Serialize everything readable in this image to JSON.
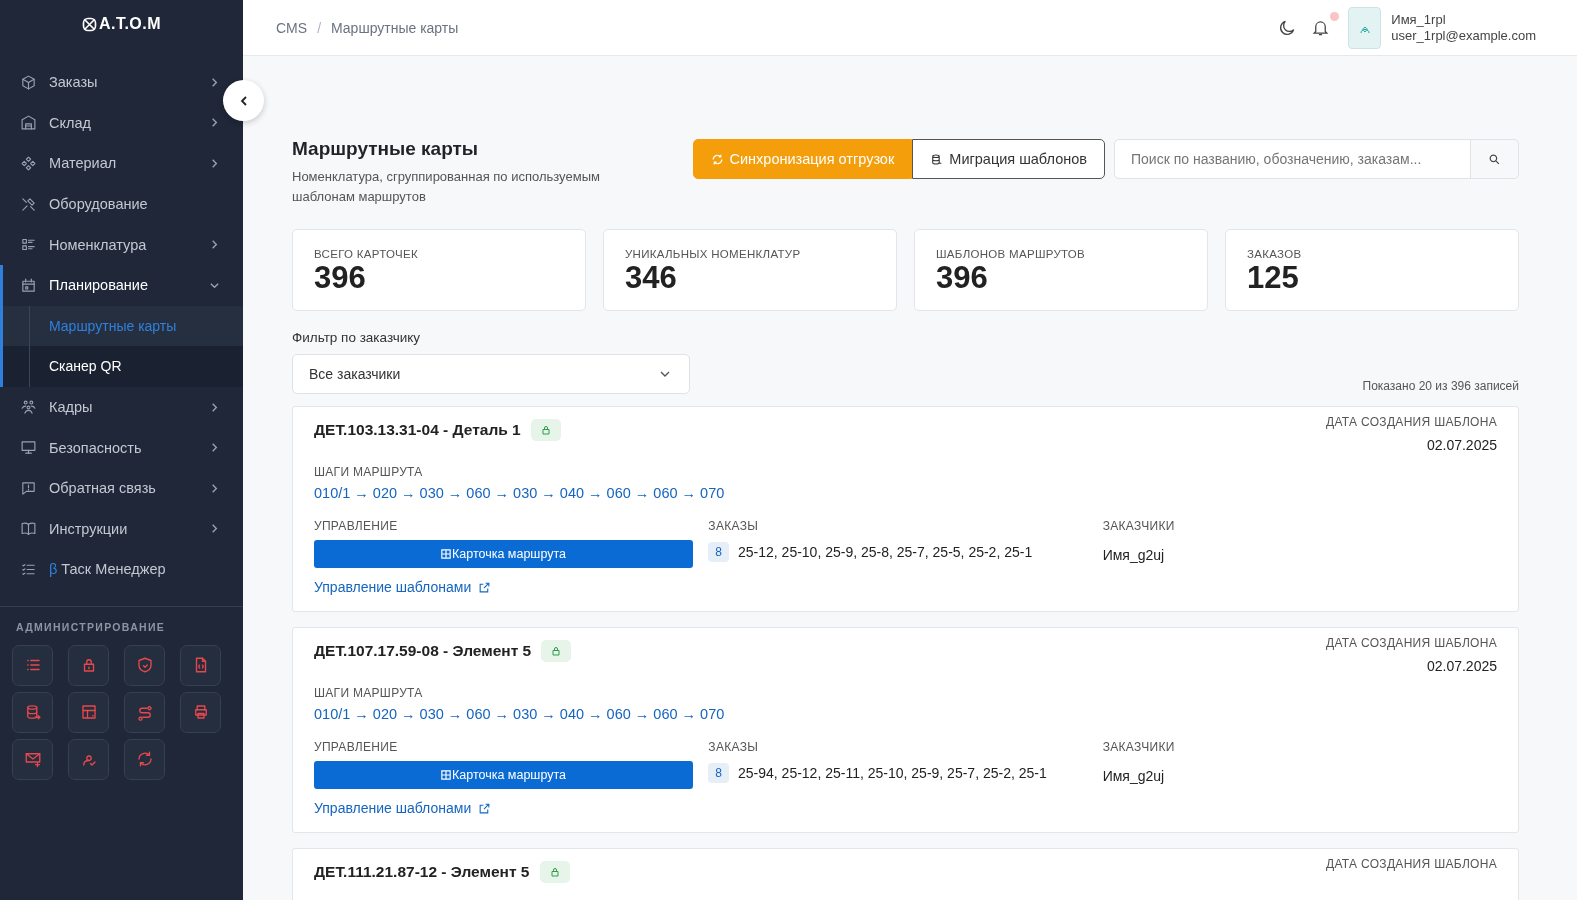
{
  "sidebar": {
    "logo": "A.T.O.M",
    "items": [
      {
        "label": "Заказы",
        "has_children": true,
        "expanded": false
      },
      {
        "label": "Склад",
        "has_children": true,
        "expanded": false
      },
      {
        "label": "Материал",
        "has_children": true,
        "expanded": false
      },
      {
        "label": "Оборудование",
        "has_children": false,
        "expanded": false
      },
      {
        "label": "Номенклатура",
        "has_children": true,
        "expanded": false
      },
      {
        "label": "Планирование",
        "has_children": true,
        "expanded": true,
        "children": [
          {
            "label": "Маршрутные карты",
            "selected": true
          },
          {
            "label": "Сканер QR",
            "selected": false
          }
        ]
      },
      {
        "label": "Кадры",
        "has_children": true,
        "expanded": false
      },
      {
        "label": "Безопасность",
        "has_children": true,
        "expanded": false
      },
      {
        "label": "Обратная связь",
        "has_children": true,
        "expanded": false
      },
      {
        "label": "Инструкции",
        "has_children": true,
        "expanded": false
      },
      {
        "label": "Таск Менеджер",
        "badge": "β",
        "has_children": false,
        "expanded": false
      }
    ],
    "admin_title": "АДМИНИСТРИРОВАНИЕ"
  },
  "breadcrumbs": [
    "CMS",
    "Маршрутные карты"
  ],
  "breadcrumb_separator": "/",
  "user": {
    "name": "Имя_1rpl",
    "email": "user_1rpl@example.com",
    "has_notifications": true
  },
  "page": {
    "title": "Маршрутные карты",
    "subtitle": "Номенклатура, сгруппированная по используемым шаблонам маршрутов",
    "sync_button": "Синхронизация отгрузок",
    "migrate_button": "Миграция шаблонов",
    "search": {
      "placeholder": "Поиск по названию, обозначению, заказам..."
    }
  },
  "stats": [
    {
      "label": "ВСЕГО КАРТОЧЕК",
      "value": "396"
    },
    {
      "label": "УНИКАЛЬНЫХ НОМЕНКЛАТУР",
      "value": "346"
    },
    {
      "label": "ШАБЛОНОВ МАРШРУТОВ",
      "value": "396"
    },
    {
      "label": "ЗАКАЗОВ",
      "value": "125"
    }
  ],
  "filter": {
    "label": "Фильтр по заказчику",
    "value": "Все заказчики"
  },
  "shown": "Показано 20 из 396 записей",
  "cards": [
    {
      "title": "ДЕТ.103.13.31-04 - Деталь 1",
      "locked": true,
      "date_label": "ДАТА СОЗДАНИЯ ШАБЛОНА",
      "date": "02.07.2025",
      "steps_label": "ШАГИ МАРШРУТА",
      "steps": "010/1 → 020 → 030 → 060 → 030 → 040 → 060 → 060 → 070",
      "control_label": "УПРАВЛЕНИЕ",
      "card_button": "Карточка маршрута",
      "templates_link": "Управление шаблонами",
      "orders_label": "ЗАКАЗЫ",
      "orders_count": "8",
      "orders": "25-12, 25-10, 25-9, 25-8, 25-7, 25-5, 25-2, 25-1",
      "customers_label": "ЗАКАЗЧИКИ",
      "customers": "Имя_g2uj"
    },
    {
      "title": "ДЕТ.107.17.59-08 - Элемент 5",
      "locked": true,
      "date_label": "ДАТА СОЗДАНИЯ ШАБЛОНА",
      "date": "02.07.2025",
      "steps_label": "ШАГИ МАРШРУТА",
      "steps": "010/1 → 020 → 030 → 060 → 030 → 040 → 060 → 060 → 070",
      "control_label": "УПРАВЛЕНИЕ",
      "card_button": "Карточка маршрута",
      "templates_link": "Управление шаблонами",
      "orders_label": "ЗАКАЗЫ",
      "orders_count": "8",
      "orders": "25-94, 25-12, 25-11, 25-10, 25-9, 25-7, 25-2, 25-1",
      "customers_label": "ЗАКАЗЧИКИ",
      "customers": "Имя_g2uj"
    },
    {
      "title": "ДЕТ.111.21.87-12 - Элемент 5",
      "locked": true,
      "date_label": "ДАТА СОЗДАНИЯ ШАБЛОНА"
    }
  ]
}
